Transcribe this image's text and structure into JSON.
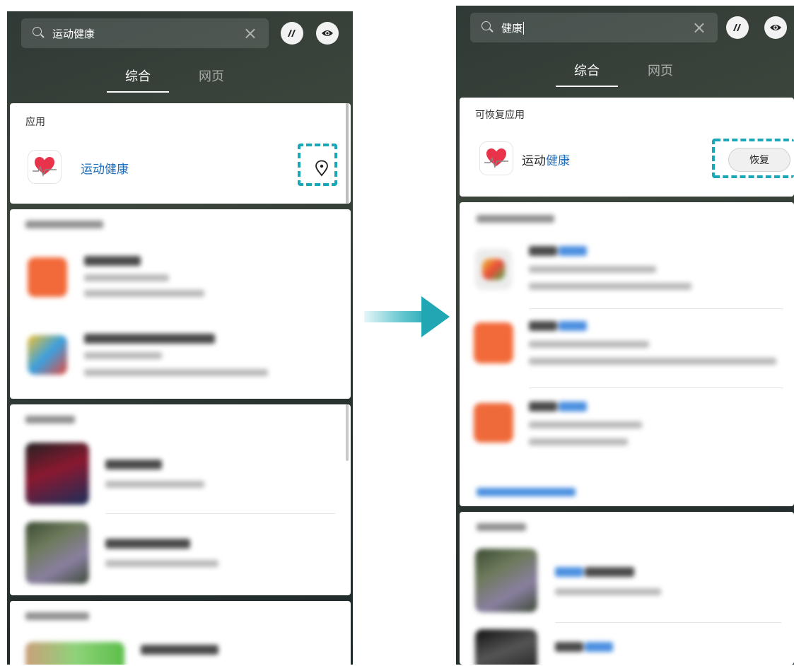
{
  "left_screen": {
    "search": {
      "query": "运动健康"
    },
    "tabs": [
      {
        "label": "综合"
      },
      {
        "label": "网页"
      }
    ],
    "apps_section": {
      "title": "应用",
      "app": {
        "name": "运动健康",
        "action_icon": "location-pin-icon"
      }
    }
  },
  "right_screen": {
    "search": {
      "query": "健康"
    },
    "tabs": [
      {
        "label": "综合"
      },
      {
        "label": "网页"
      }
    ],
    "restorable_section": {
      "title": "可恢复应用",
      "app": {
        "name_plain": "运动",
        "name_highlight": "健康",
        "restore_button": "恢复"
      }
    }
  },
  "colors": {
    "accent_teal": "#1aa8b8",
    "link_blue": "#1f6fbf"
  }
}
